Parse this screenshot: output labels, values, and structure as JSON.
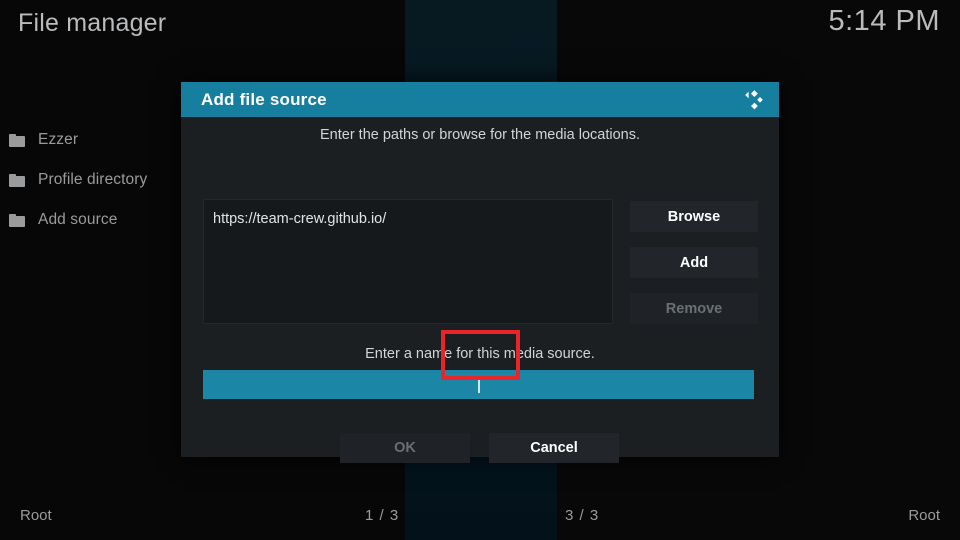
{
  "app": {
    "title": "File manager",
    "clock": "5:14 PM"
  },
  "sidebar": {
    "items": [
      {
        "label": "Ezzer",
        "icon": "folder-icon"
      },
      {
        "label": "Profile directory",
        "icon": "folder-icon"
      },
      {
        "label": "Add source",
        "icon": "folder-icon"
      }
    ]
  },
  "statusbar": {
    "left": "Root",
    "page_left": "1 / 3",
    "page_right": "3 / 3",
    "right": "Root"
  },
  "dialog": {
    "title": "Add file source",
    "logo_icon": "kodi-logo-icon",
    "paths_hint": "Enter the paths or browse for the media locations.",
    "paths": [
      "https://team-crew.github.io/"
    ],
    "buttons": {
      "browse": "Browse",
      "add": "Add",
      "remove": "Remove"
    },
    "name_hint": "Enter a name for this media source.",
    "name_value": "",
    "ok": "OK",
    "cancel": "Cancel"
  },
  "colors": {
    "accent": "#167fa0",
    "field_focus": "#1c86a6",
    "annotation": "#e8262a",
    "dialog_bg": "#1b1f22"
  }
}
